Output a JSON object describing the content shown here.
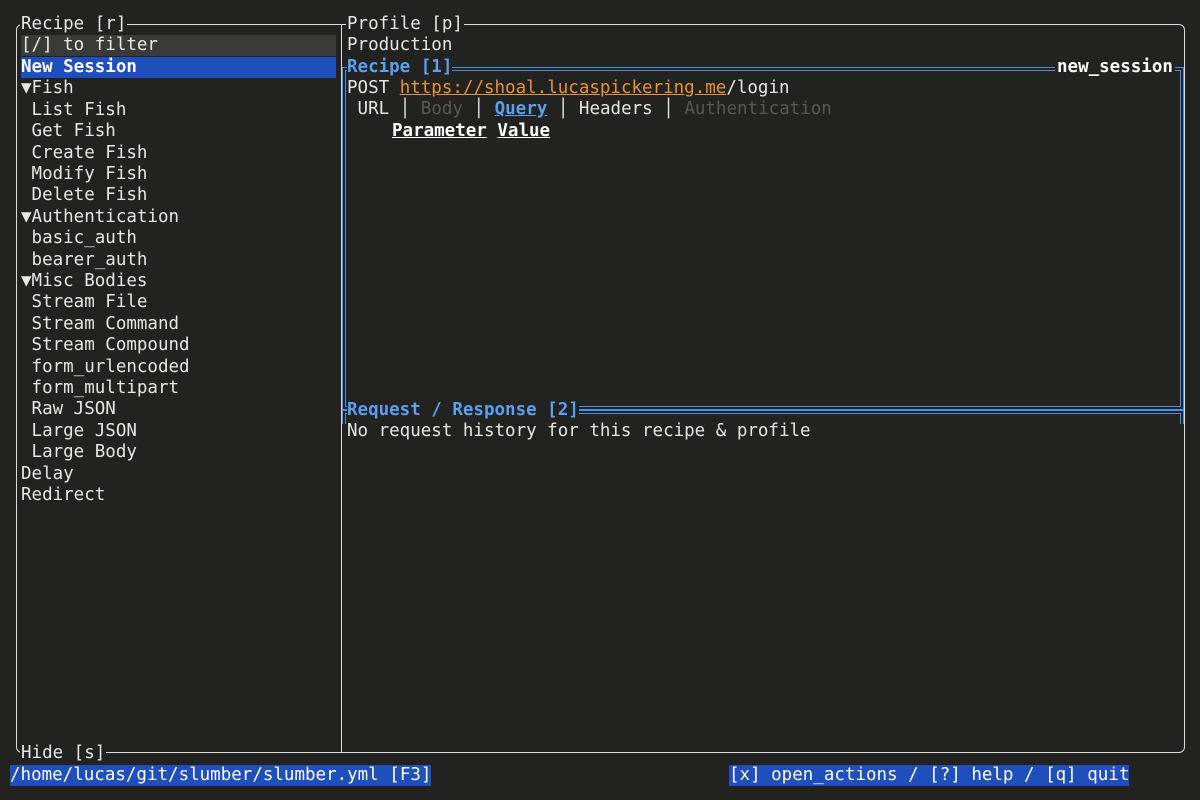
{
  "sidebar": {
    "title": "Recipe [r]",
    "filter_placeholder": "[/] to filter",
    "hide_label": "Hide [s]",
    "items": [
      {
        "label": "New Session",
        "selected": true
      },
      {
        "label": "▼Fish"
      },
      {
        "label": " List Fish"
      },
      {
        "label": " Get Fish"
      },
      {
        "label": " Create Fish"
      },
      {
        "label": " Modify Fish"
      },
      {
        "label": " Delete Fish"
      },
      {
        "label": "▼Authentication"
      },
      {
        "label": " basic_auth"
      },
      {
        "label": " bearer_auth"
      },
      {
        "label": "▼Misc Bodies"
      },
      {
        "label": " Stream File"
      },
      {
        "label": " Stream Command"
      },
      {
        "label": " Stream Compound"
      },
      {
        "label": " form_urlencoded"
      },
      {
        "label": " form_multipart"
      },
      {
        "label": " Raw JSON"
      },
      {
        "label": " Large JSON"
      },
      {
        "label": " Large Body"
      },
      {
        "label": "Delay"
      },
      {
        "label": "Redirect"
      }
    ]
  },
  "profile": {
    "title": "Profile [p]",
    "value": "Production"
  },
  "recipe": {
    "title": "Recipe [1]",
    "id": "new_session",
    "method": "POST",
    "url_base": "https://shoal.lucaspickering.me",
    "url_path": "/login",
    "tabs": {
      "url": "URL",
      "body": "Body",
      "query": "Query",
      "headers": "Headers",
      "authentication": "Authentication"
    },
    "query_columns": {
      "parameter": "Parameter",
      "value": "Value"
    }
  },
  "response": {
    "title": "Request / Response [2]",
    "empty_message": "No request history for this recipe & profile"
  },
  "footer": {
    "path": "/home/lucas/git/slumber/slumber.yml [F3]",
    "shortcuts": "[x] open_actions / [?] help / [q] quit"
  },
  "colors": {
    "background": "#222221",
    "accent_blue": "#1f4fbd",
    "pane_border": "#4b8fe0",
    "url_orange": "#e8952c"
  }
}
